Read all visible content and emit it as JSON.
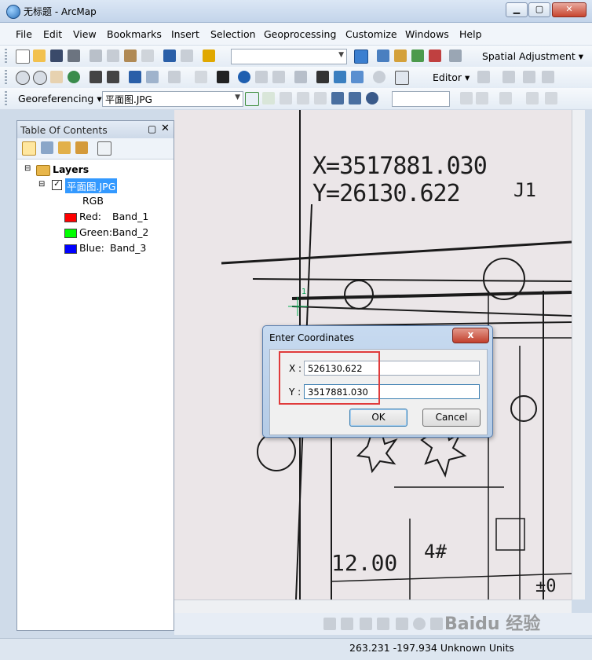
{
  "window": {
    "title": "无标题 - ArcMap",
    "controls": [
      "0",
      "1",
      "r"
    ]
  },
  "menubar": [
    "File",
    "Edit",
    "View",
    "Bookmarks",
    "Insert",
    "Selection",
    "Geoprocessing",
    "Customize",
    "Windows",
    "Help"
  ],
  "toolbars": {
    "spatial_adjustment_label": "Spatial Adjustment",
    "editor_label": "Editor",
    "georeferencing_label": "Georeferencing",
    "layer_select_value": "平面图.JPG",
    "scale_value": "",
    "combo_value": ""
  },
  "toc": {
    "title": "Table Of Contents",
    "layers_label": "Layers",
    "layer_name": "平面图.JPG",
    "layer_checked": true,
    "render_type": "RGB",
    "bands": [
      {
        "label": "Red:",
        "band": "Band_1",
        "color": "#ff0000"
      },
      {
        "label": "Green:",
        "band": "Band_2",
        "color": "#00ff00"
      },
      {
        "label": "Blue:",
        "band": "Band_3",
        "color": "#0000ff"
      }
    ]
  },
  "map": {
    "text_x": "X=3517881.030",
    "text_y": "Y=26130.622",
    "text_j1": "J1",
    "text_point": "1",
    "text_1200": "12.00",
    "text_4": "4#",
    "text_pm": "±0"
  },
  "dialog": {
    "title": "Enter Coordinates",
    "close": "x",
    "x_label": "X :",
    "x_value": "526130.622",
    "y_label": "Y :",
    "y_value": "3517881.030",
    "ok_label": "OK",
    "cancel_label": "Cancel",
    "highlight_color": "#e03b3b"
  },
  "status": {
    "coords": "263.231  -197.934 Unknown Units"
  },
  "watermark": "Baidu 经验"
}
